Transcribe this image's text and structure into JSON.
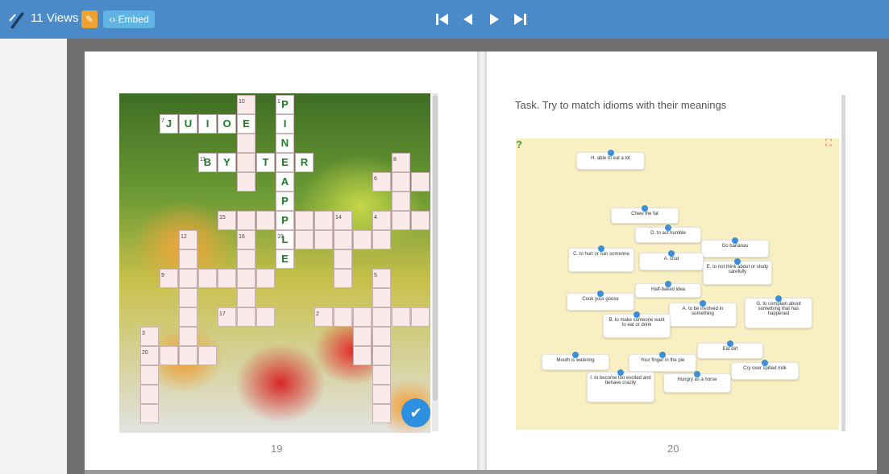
{
  "toolbar": {
    "views": "11 Views",
    "edit_icon": "pencil-icon",
    "embed": "Embed",
    "embed_icon": "code-icon"
  },
  "nav": {
    "first": "first-page-icon",
    "prev": "previous-page-icon",
    "next": "next-page-icon",
    "last": "last-page-icon"
  },
  "left_page": {
    "number": "19"
  },
  "right_page": {
    "number": "20",
    "task": "Task. Try to match idioms with their meanings"
  },
  "crossword": {
    "juice": [
      "J",
      "U",
      "I",
      "O",
      "E"
    ],
    "bytter": [
      "B",
      "Y",
      "T",
      "T",
      "E",
      "R"
    ],
    "pineapple": [
      "P",
      "I",
      "N",
      "E",
      "A",
      "P",
      "P",
      "L",
      "E"
    ],
    "numbers": {
      "n7": "7",
      "n10": "10",
      "n1": "1",
      "n11": "11",
      "n8": "8",
      "n6": "6",
      "n15": "15",
      "n14": "14",
      "n4": "4",
      "n12": "12",
      "n16": "16",
      "n19": "19",
      "n9": "9",
      "n5": "5",
      "n17": "17",
      "n2": "2",
      "n3": "3",
      "n20": "20"
    }
  },
  "cards": [
    "H. able to eat a lot",
    "Chew the fat",
    "D. to act humble",
    "Go bananas",
    "C. to hurt or ruin someone",
    "A. chat",
    "E. to not think about or study carefully",
    "Half-baked idea",
    "Cook your goose",
    "A. to be involved in something",
    "G. to complain about something that has happened",
    "B. to make someone want to eat or drink",
    "Eat dirt",
    "Mouth is watering",
    "Your finger in the pie",
    "Cry over spilled milk",
    "I. to become too excited and behave crazily",
    "Hungry as a horse"
  ],
  "colors": {
    "toolbar": "#4a8ac9",
    "edit": "#f0a230",
    "embed": "#5fb4e3",
    "letters": "#1d7a28",
    "board": "#f8efc2",
    "dot": "#3a8fd8"
  }
}
